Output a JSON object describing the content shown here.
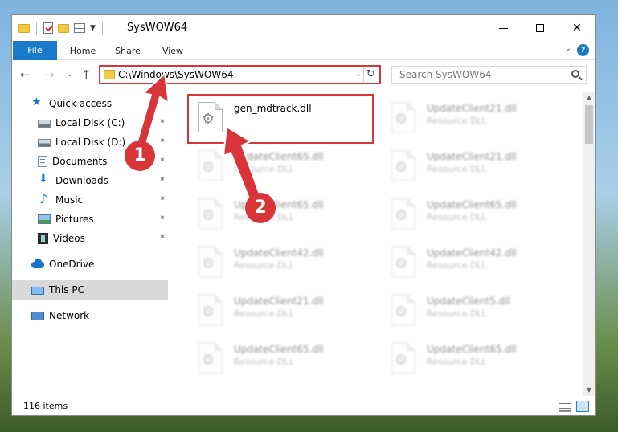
{
  "window": {
    "title": "SysWOW64",
    "controls": {
      "minimize": "",
      "maximize": "",
      "close": "✕"
    }
  },
  "ribbon": {
    "tabs": [
      {
        "label": "File"
      },
      {
        "label": "Home"
      },
      {
        "label": "Share"
      },
      {
        "label": "View"
      }
    ],
    "expand": "⌄",
    "help": "?"
  },
  "nav": {
    "back": "←",
    "forward": "→",
    "recent": "⌄",
    "up": "↑",
    "address": "C:\\Windows\\SysWOW64",
    "address_dropdown": "⌄",
    "refresh": "↻",
    "search_placeholder": "Search SysWOW64"
  },
  "sidebar": {
    "quick_access": "Quick access",
    "pinned": [
      {
        "label": "Local Disk (C:)",
        "icon": "drive-icon"
      },
      {
        "label": "Local Disk (D:)",
        "icon": "drive-icon"
      },
      {
        "label": "Documents",
        "icon": "documents-icon"
      },
      {
        "label": "Downloads",
        "icon": "downloads-icon"
      },
      {
        "label": "Music",
        "icon": "music-icon"
      },
      {
        "label": "Pictures",
        "icon": "pictures-icon"
      },
      {
        "label": "Videos",
        "icon": "videos-icon"
      }
    ],
    "onedrive": "OneDrive",
    "this_pc": "This PC",
    "network": "Network",
    "pin_glyph": "📌"
  },
  "files": [
    {
      "name": "gen_mdtrack.dll",
      "type": ""
    },
    {
      "name": "UpdateClient21.dll",
      "type": "Resource DLL"
    },
    {
      "name": "UpdateClient65.dll",
      "type": "Resource DLL"
    },
    {
      "name": "UpdateClient21.dll",
      "type": "Resource DLL"
    },
    {
      "name": "UpdateClient65.dll",
      "type": "Resource DLL"
    },
    {
      "name": "UpdateClient65.dll",
      "type": "Resource DLL"
    },
    {
      "name": "UpdateClient42.dll",
      "type": "Resource DLL"
    },
    {
      "name": "UpdateClient42.dll",
      "type": "Resource DLL"
    },
    {
      "name": "UpdateClient21.dll",
      "type": "Resource DLL"
    },
    {
      "name": "UpdateClient5.dll",
      "type": "Resource DLL"
    },
    {
      "name": "UpdateClient65.dll",
      "type": "Resource DLL"
    },
    {
      "name": "UpdateClient65.dll",
      "type": "Resource DLL"
    }
  ],
  "status": {
    "item_count": "116 items"
  },
  "annotations": {
    "step1": "1",
    "step2": "2",
    "color": "#d8343a"
  }
}
